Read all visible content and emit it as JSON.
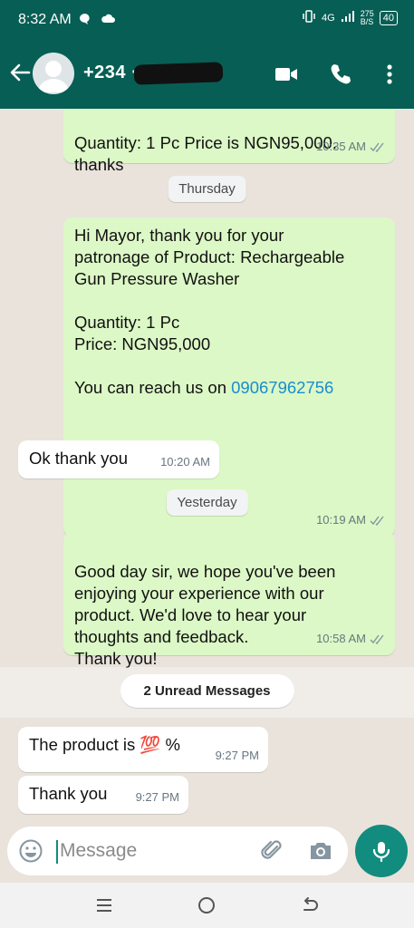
{
  "status_bar": {
    "time": "8:32 AM",
    "network": "4G",
    "speed": "275\nB/S",
    "battery": "40"
  },
  "header": {
    "contact_name": "+234 ··· 65...",
    "icons": [
      "back-arrow-icon",
      "avatar",
      "video-call-icon",
      "phone-icon",
      "more-vert-icon"
    ]
  },
  "messages": [
    {
      "type": "out",
      "text": "Quantity: 1 Pc Price is NGN95,000.\nthanks",
      "time": "10:35 AM",
      "ticks": "double-grey"
    },
    {
      "date": "Thursday"
    },
    {
      "type": "out",
      "text": "Hi Mayor, thank you for your\npatronage of Product: Rechargeable\nGun Pressure Washer\n\nQuantity: 1 Pc\nPrice: NGN95,000\n\nYou can reach us on ",
      "link": "09067962756",
      "time": "10:19 AM",
      "ticks": "double-grey"
    },
    {
      "type": "in",
      "text": "Ok thank you",
      "time": "10:20 AM"
    },
    {
      "date": "Yesterday"
    },
    {
      "type": "out",
      "text": "Good day sir, we hope you've been\nenjoying your experience with our\nproduct. We'd love to hear your\nthoughts and feedback.\nThank you!",
      "time": "10:58 AM",
      "ticks": "double-grey"
    },
    {
      "unread": "2 Unread Messages"
    },
    {
      "type": "in",
      "text": "The product is ",
      "emoji": "💯",
      "suffix": " %",
      "time": "9:27 PM"
    },
    {
      "type": "in",
      "text": "Thank you",
      "time": "9:27 PM"
    }
  ],
  "composer": {
    "placeholder": "Message"
  },
  "colors": {
    "header": "#075e54",
    "outgoing_bubble": "#dcf8c6",
    "incoming_bubble": "#ffffff",
    "link": "#1a8dcf",
    "fab": "#128c7e"
  }
}
